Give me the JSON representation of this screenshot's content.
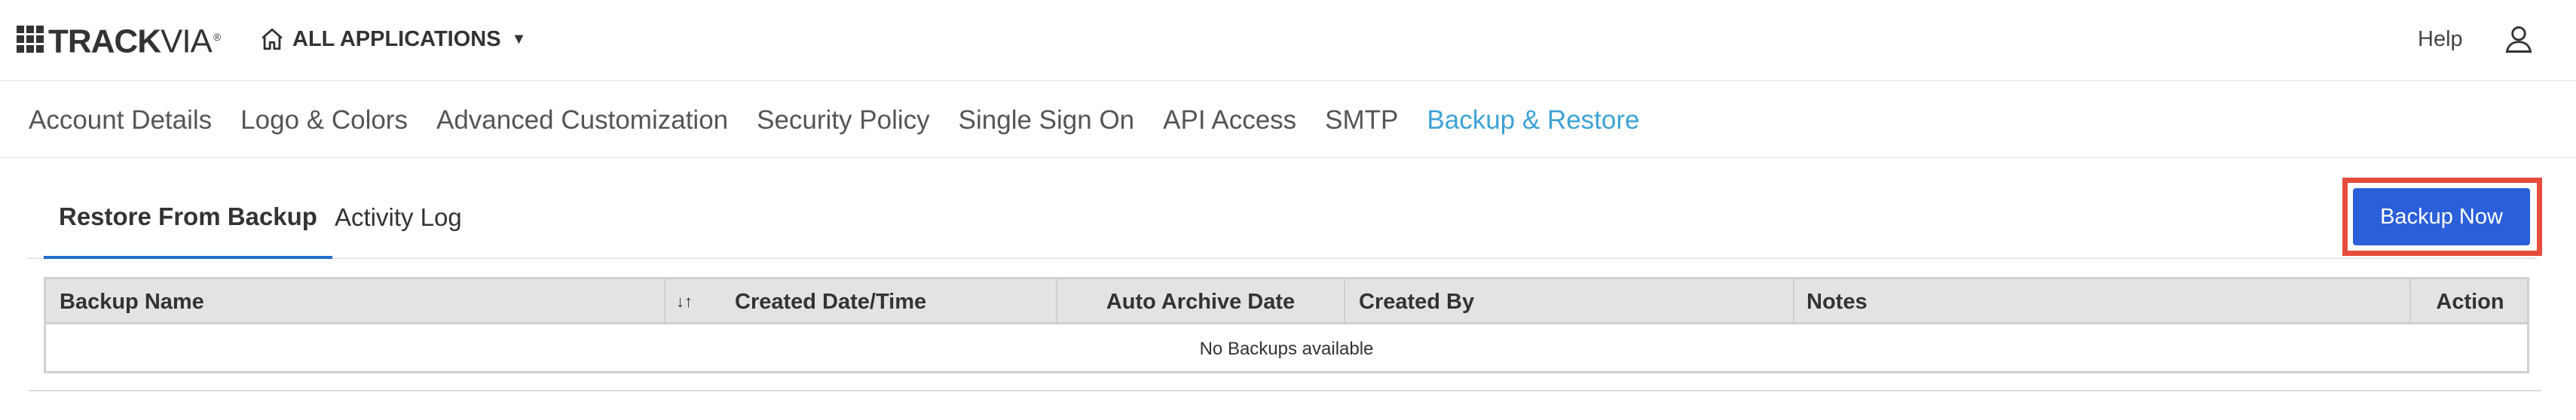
{
  "header": {
    "logo_bold": "TRACK",
    "logo_light": "VIA",
    "logo_tm": "®",
    "apps_label": "ALL APPLICATIONS",
    "apps_caret": "▼",
    "help_label": "Help"
  },
  "settings_nav": {
    "items": [
      {
        "label": "Account Details"
      },
      {
        "label": "Logo & Colors"
      },
      {
        "label": "Advanced Customization"
      },
      {
        "label": "Security Policy"
      },
      {
        "label": "Single Sign On"
      },
      {
        "label": "API Access"
      },
      {
        "label": "SMTP"
      },
      {
        "label": "Backup & Restore"
      }
    ],
    "active": "Backup & Restore",
    "active_color": "#3da2d5"
  },
  "subtabs": {
    "items": [
      {
        "label": "Restore From Backup"
      },
      {
        "label": "Activity Log"
      }
    ],
    "active": "Restore From Backup"
  },
  "backup_button": {
    "label": "Backup Now",
    "color": "#2b5fd9",
    "highlight_color": "#e74c3c"
  },
  "table": {
    "columns": [
      "Backup Name",
      "Created Date/Time",
      "Auto Archive Date",
      "Created By",
      "Notes",
      "Action"
    ],
    "sort_icon": "↓↑",
    "empty_message": "No Backups available"
  },
  "icons": {
    "home": "home-icon",
    "user": "user-icon",
    "sort": "sort-icon"
  }
}
